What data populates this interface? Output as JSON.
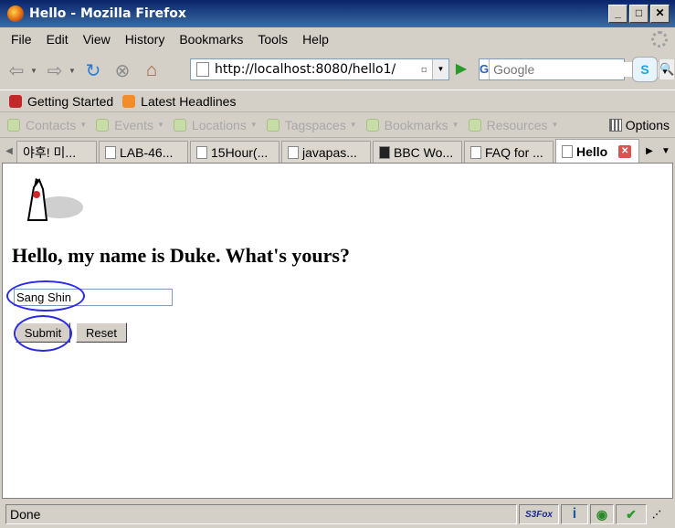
{
  "window": {
    "title": "Hello - Mozilla Firefox"
  },
  "menu": {
    "items": [
      "File",
      "Edit",
      "View",
      "History",
      "Bookmarks",
      "Tools",
      "Help"
    ]
  },
  "nav": {
    "url": "http://localhost:8080/hello1/",
    "search_placeholder": "Google",
    "search_engine": "G"
  },
  "bookmarks": {
    "items": [
      "Getting Started",
      "Latest Headlines"
    ]
  },
  "extbar": {
    "items": [
      "Contacts",
      "Events",
      "Locations",
      "Tagspaces",
      "Bookmarks",
      "Resources"
    ],
    "options": "Options"
  },
  "tabs": {
    "items": [
      "야후! 미...",
      "LAB-46...",
      "15Hour(...",
      "javapas...",
      "BBC Wo...",
      "FAQ for ...",
      "Hello"
    ]
  },
  "page": {
    "heading": "Hello, my name is Duke. What's yours?",
    "name_value": "Sang Shin",
    "submit_label": "Submit",
    "reset_label": "Reset"
  },
  "status": {
    "text": "Done",
    "s3fox": "S3Fox"
  },
  "colors": {
    "titlebar": "#0a246a",
    "annotation": "#2a2ae8"
  }
}
